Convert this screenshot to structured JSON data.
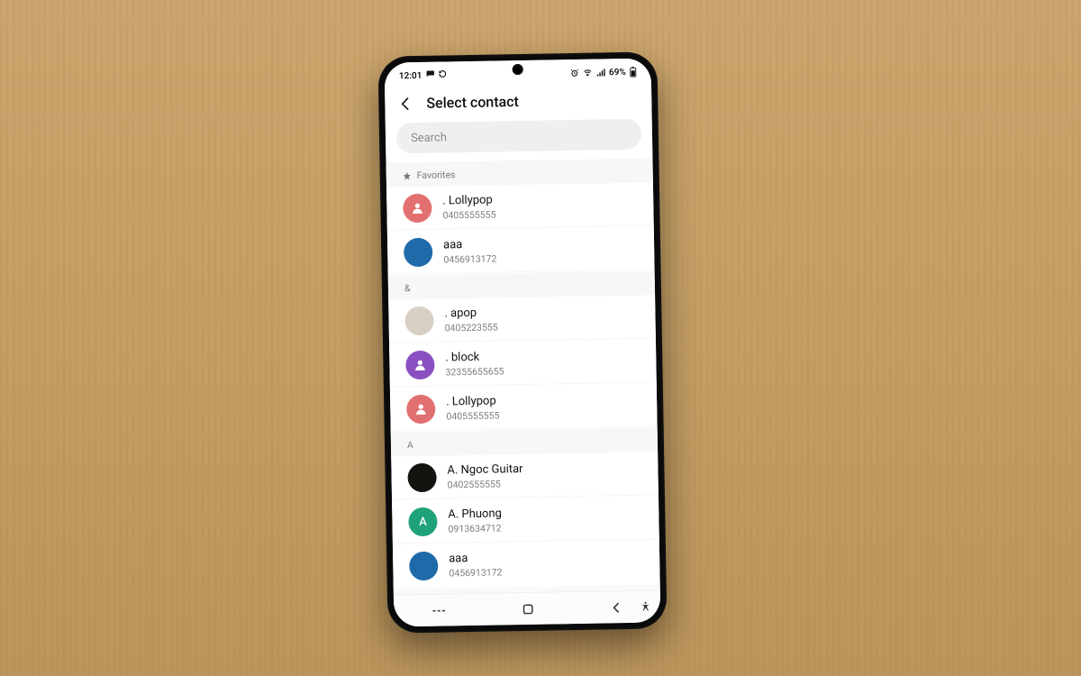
{
  "status": {
    "time": "12:01",
    "battery": "69%"
  },
  "header": {
    "title": "Select contact"
  },
  "search": {
    "placeholder": "Search"
  },
  "sections": [
    {
      "id": "fav",
      "label": "Favorites",
      "icon": "star",
      "items": [
        {
          "name": ". Lollypop",
          "number": "0405555555",
          "avatar_type": "person-icon",
          "avatar_bg": "#e27070"
        },
        {
          "name": "aaa",
          "number": "0456913172",
          "avatar_type": "image",
          "avatar_bg": "#1f6aa9"
        }
      ]
    },
    {
      "id": "amp",
      "label": "&",
      "items": [
        {
          "name": ". apop",
          "number": "0405223555",
          "avatar_type": "image",
          "avatar_bg": "#d8cfc5"
        },
        {
          "name": ". block",
          "number": "32355655655",
          "avatar_type": "person-icon",
          "avatar_bg": "#8a4fc0"
        },
        {
          "name": ". Lollypop",
          "number": "0405555555",
          "avatar_type": "person-icon",
          "avatar_bg": "#e27070"
        }
      ]
    },
    {
      "id": "A",
      "label": "A",
      "items": [
        {
          "name": "A. Ngoc Guitar",
          "number": "0402555555",
          "avatar_type": "image",
          "avatar_bg": "#14130f"
        },
        {
          "name": "A. Phuong",
          "number": "0913634712",
          "avatar_type": "letter",
          "avatar_letter": "A",
          "avatar_bg": "#1fa27a"
        },
        {
          "name": "aaa",
          "number": "0456913172",
          "avatar_type": "image",
          "avatar_bg": "#1f6aa9"
        }
      ]
    }
  ]
}
